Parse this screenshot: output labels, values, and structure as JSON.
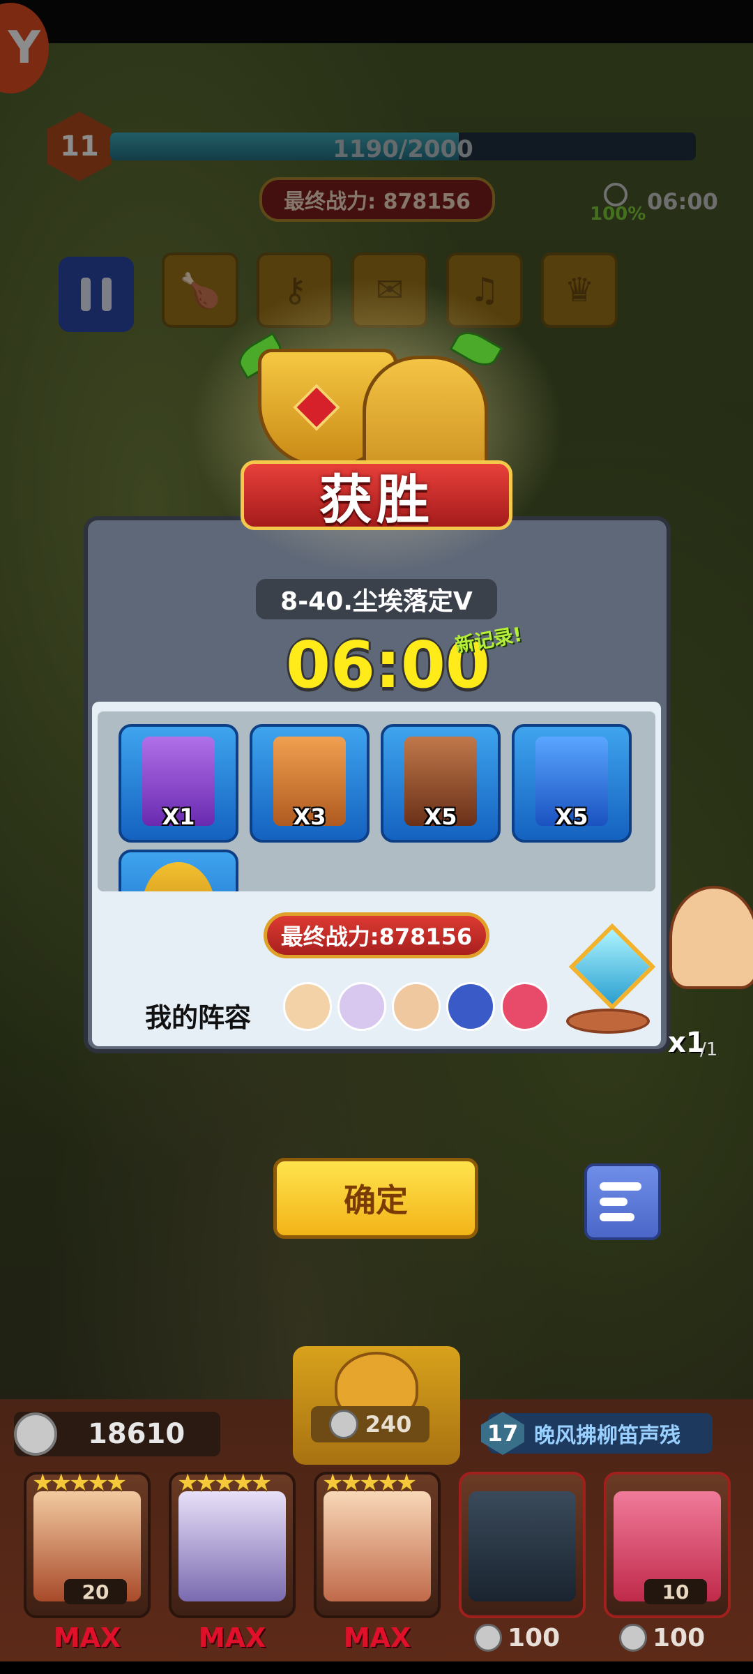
{
  "hud": {
    "level": "11",
    "xp_text": "1190/2000",
    "xp_progress": 0.595,
    "top_power": "最终战力: 878156",
    "timer": "06:00",
    "completion": "100%",
    "skill_icons": [
      "drumstick-icon",
      "key-icon",
      "map-icon",
      "harp-icon",
      "crown-icon"
    ]
  },
  "victory": {
    "banner": "获胜",
    "stage": "8-40.尘埃落定Ⅴ",
    "time": "06:00",
    "new_record": "新记录!"
  },
  "rewards": [
    {
      "name": "minion-hero-card",
      "qty": "X1",
      "color": "#8a3fd6"
    },
    {
      "name": "pirate-hero-card",
      "qty": "X3",
      "color": "#e08a30"
    },
    {
      "name": "goggles-hero-card",
      "qty": "X5",
      "color": "#8a4a2a"
    },
    {
      "name": "blue-ninja-hero-card",
      "qty": "X5",
      "color": "#2a7ae8"
    }
  ],
  "summary": {
    "final_power": "最终战力:878156",
    "lineup_label": "我的阵容",
    "lineup_avatars": [
      "#f4d2a8",
      "#d8c8f0",
      "#f0c8a0",
      "#3a5ac8",
      "#e84a6a"
    ]
  },
  "buttons": {
    "confirm": "确定"
  },
  "side": {
    "count": "x1",
    "sub": "/1"
  },
  "bottom": {
    "coins": "18610",
    "summon_cost": "240",
    "event_level": "17",
    "event_name": "晚风拂柳笛声残",
    "heroes": [
      {
        "level": "20",
        "status": "MAX",
        "stars": "★★★★★"
      },
      {
        "level": "",
        "status": "MAX",
        "stars": "★★★★★"
      },
      {
        "level": "",
        "status": "MAX",
        "stars": "★★★★★"
      },
      {
        "level": "",
        "cost": "100"
      },
      {
        "level": "10",
        "cost": "100"
      }
    ]
  }
}
